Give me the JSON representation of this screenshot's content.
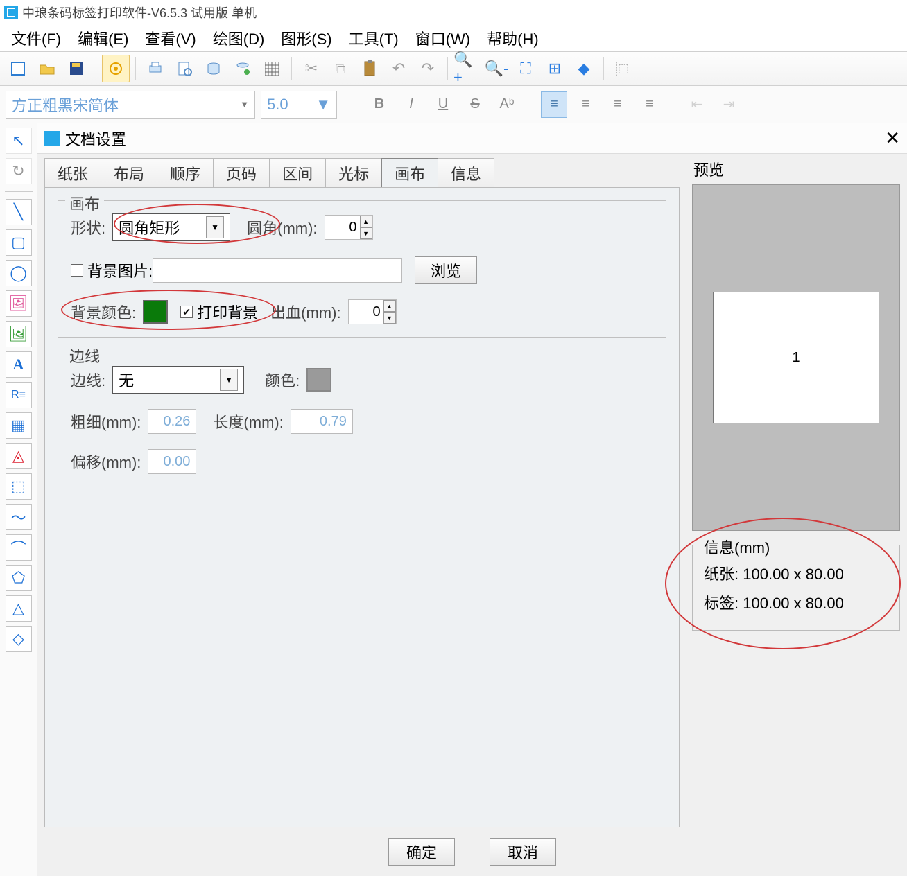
{
  "titlebar": {
    "text": "中琅条码标签打印软件-V6.5.3 试用版 单机"
  },
  "menu": {
    "file": "文件(F)",
    "edit": "编辑(E)",
    "view": "查看(V)",
    "draw": "绘图(D)",
    "graphic": "图形(S)",
    "tool": "工具(T)",
    "window": "窗口(W)",
    "help": "帮助(H)"
  },
  "font": {
    "name": "方正粗黑宋简体",
    "size": "5.0"
  },
  "dialog": {
    "title": "文档设置",
    "tabs": [
      "纸张",
      "布局",
      "顺序",
      "页码",
      "区间",
      "光标",
      "画布",
      "信息"
    ],
    "activeTabIndex": 6,
    "canvas": {
      "groupTitle": "画布",
      "shapeLabel": "形状:",
      "shapeValue": "圆角矩形",
      "cornerLabel": "圆角(mm):",
      "cornerValue": "0",
      "bgImgLabel": "背景图片:",
      "bgImgPath": "",
      "browse": "浏览",
      "bgColorLabel": "背景颜色:",
      "bgColor": "#0a7a0a",
      "printBgLabel": "打印背景",
      "bleedLabel": "出血(mm):",
      "bleedValue": "0"
    },
    "border": {
      "groupTitle": "边线",
      "borderLabel": "边线:",
      "borderValue": "无",
      "colorLabel": "颜色:",
      "widthLabel": "粗细(mm):",
      "widthValue": "0.26",
      "lenLabel": "长度(mm):",
      "lenValue": "0.79",
      "offsetLabel": "偏移(mm):",
      "offsetValue": "0.00"
    },
    "preview": {
      "title": "预览",
      "pageNum": "1"
    },
    "info": {
      "title": "信息(mm)",
      "paperLabel": "纸张:",
      "paperValue": "100.00 x 80.00",
      "labelLabel": "标签:",
      "labelValue": "100.00 x 80.00"
    },
    "ok": "确定",
    "cancel": "取消"
  }
}
